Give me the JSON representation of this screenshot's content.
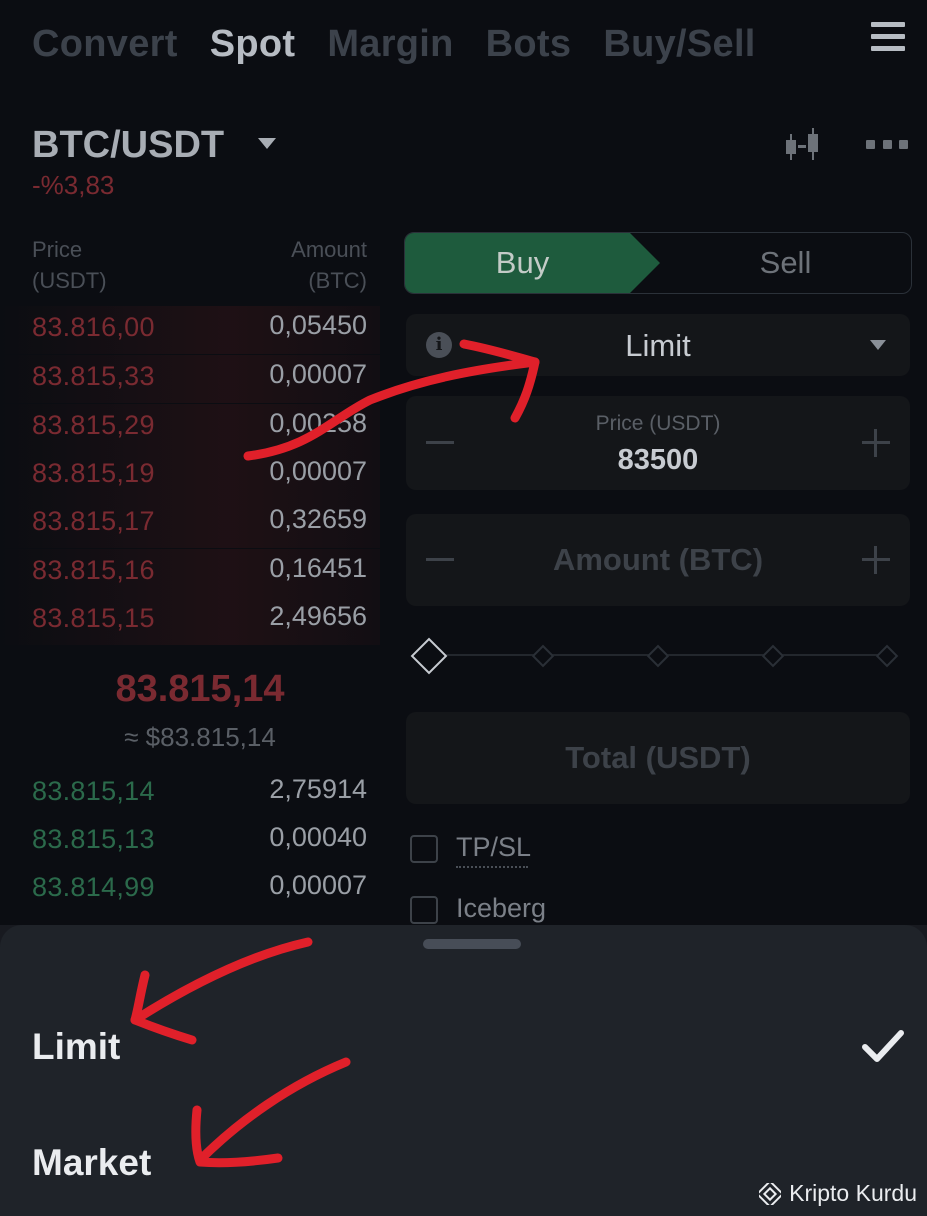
{
  "tabs": [
    {
      "label": "Convert",
      "active": false
    },
    {
      "label": "Spot",
      "active": true
    },
    {
      "label": "Margin",
      "active": false
    },
    {
      "label": "Bots",
      "active": false
    },
    {
      "label": "Buy/Sell",
      "active": false
    }
  ],
  "pair": {
    "symbol": "BTC/USDT",
    "change": "-%3,83"
  },
  "orderbook": {
    "price_header_line1": "Price",
    "price_header_line2": "(USDT)",
    "amount_header_line1": "Amount",
    "amount_header_line2": "(BTC)",
    "asks": [
      {
        "price": "83.816,00",
        "amount": "0,05450"
      },
      {
        "price": "83.815,33",
        "amount": "0,00007"
      },
      {
        "price": "83.815,29",
        "amount": "0,00258"
      },
      {
        "price": "83.815,19",
        "amount": "0,00007"
      },
      {
        "price": "83.815,17",
        "amount": "0,32659"
      },
      {
        "price": "83.815,16",
        "amount": "0,16451"
      },
      {
        "price": "83.815,15",
        "amount": "2,49656"
      }
    ],
    "mid_price": "83.815,14",
    "mid_usd": "≈ $83.815,14",
    "bids": [
      {
        "price": "83.815,14",
        "amount": "2,75914"
      },
      {
        "price": "83.815,13",
        "amount": "0,00040"
      },
      {
        "price": "83.814,99",
        "amount": "0,00007"
      }
    ]
  },
  "form": {
    "buy_label": "Buy",
    "sell_label": "Sell",
    "order_type": "Limit",
    "price_label": "Price (USDT)",
    "price_value": "83500",
    "amount_placeholder": "Amount (BTC)",
    "total_placeholder": "Total (USDT)",
    "tpsl_label": "TP/SL",
    "iceberg_label": "Iceberg",
    "slider_percent": 0
  },
  "sheet": {
    "options": [
      {
        "label": "Limit",
        "selected": true
      },
      {
        "label": "Market",
        "selected": false
      }
    ]
  },
  "watermark": "Kripto Kurdu",
  "colors": {
    "background": "#181a20",
    "buy_green": "#1e5b3d",
    "ask_red": "#7a2a31",
    "bid_green": "#2b6a4b",
    "annotation_red": "#e0202a"
  }
}
